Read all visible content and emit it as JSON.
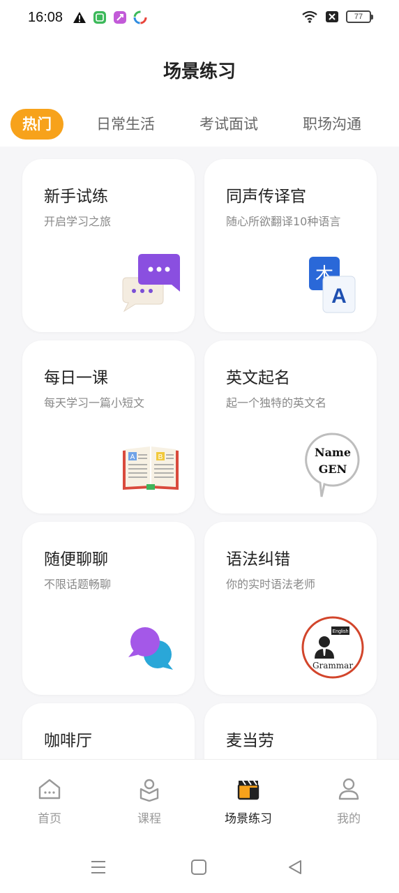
{
  "status_bar": {
    "time": "16:08",
    "battery": "77",
    "icons": [
      "warning-icon",
      "app-icon-green",
      "app-icon-purple",
      "app-icon-colorful",
      "wifi-icon",
      "sim-off-icon",
      "battery-icon"
    ]
  },
  "header": {
    "title": "场景练习"
  },
  "tabs": [
    {
      "label": "热门",
      "active": true
    },
    {
      "label": "日常生活",
      "active": false
    },
    {
      "label": "考试面试",
      "active": false
    },
    {
      "label": "职场沟通",
      "active": false
    }
  ],
  "cards": [
    {
      "title": "新手试练",
      "subtitle": "开启学习之旅",
      "icon": "chat-bubbles-icon"
    },
    {
      "title": "同声传译官",
      "subtitle": "随心所欲翻译10种语言",
      "icon": "translate-icon"
    },
    {
      "title": "每日一课",
      "subtitle": "每天学习一篇小短文",
      "icon": "open-book-icon"
    },
    {
      "title": "英文起名",
      "subtitle": "起一个独特的英文名",
      "icon": "name-badge-icon",
      "badge_line1": "Name",
      "badge_line2": "GEN"
    },
    {
      "title": "随便聊聊",
      "subtitle": "不限话题畅聊",
      "icon": "chat-bubbles-color-icon"
    },
    {
      "title": "语法纠错",
      "subtitle": "你的实时语法老师",
      "icon": "grammar-teacher-icon",
      "badge_top": "English",
      "badge_bottom": "Grammar"
    },
    {
      "title": "咖啡厅",
      "subtitle": "",
      "icon": ""
    },
    {
      "title": "麦当劳",
      "subtitle": "",
      "icon": ""
    }
  ],
  "bottom_nav": [
    {
      "label": "首页",
      "icon": "home-icon",
      "active": false
    },
    {
      "label": "课程",
      "icon": "course-icon",
      "active": false
    },
    {
      "label": "场景练习",
      "icon": "clapperboard-icon",
      "active": true
    },
    {
      "label": "我的",
      "icon": "profile-icon",
      "active": false
    }
  ],
  "colors": {
    "accent": "#f7a21b",
    "background": "#f6f6f8",
    "card": "#ffffff",
    "text_primary": "#222222",
    "text_secondary": "#888888"
  }
}
